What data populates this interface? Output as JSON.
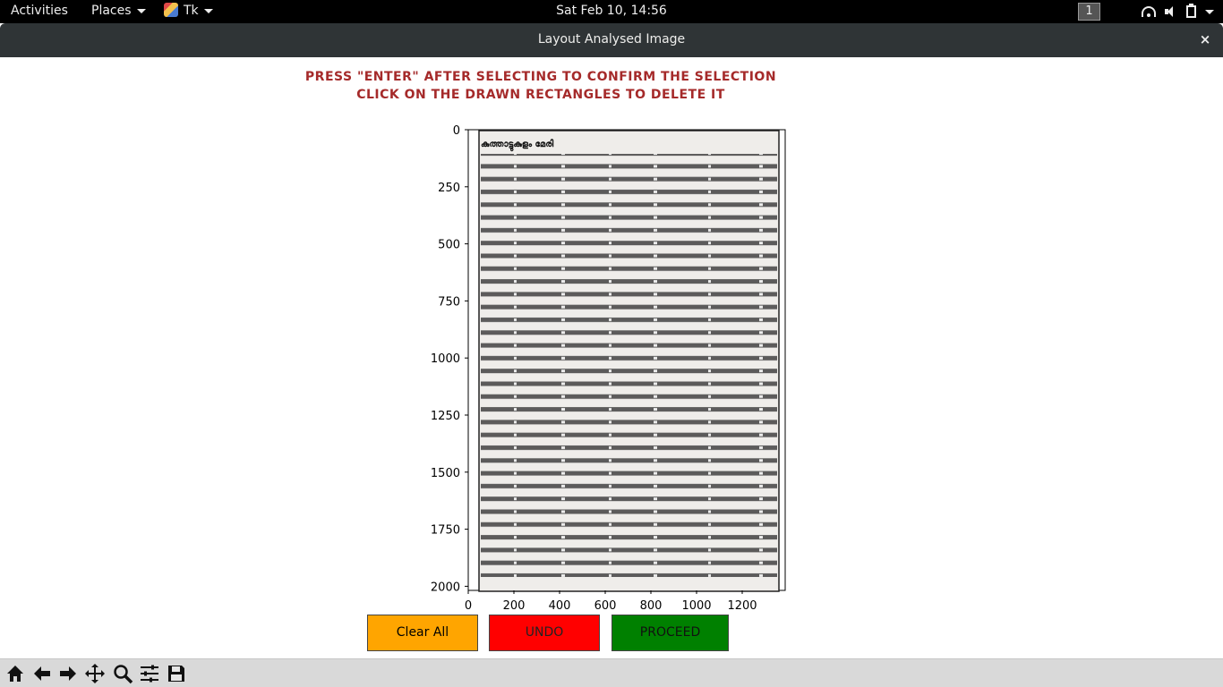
{
  "topbar": {
    "activities": "Activities",
    "places": "Places",
    "app_name": "Tk",
    "clock": "Sat Feb 10, 14:56",
    "workspace": "1"
  },
  "window": {
    "title": "Layout Analysed Image",
    "close": "×"
  },
  "instructions": {
    "line1": "PRESS \"ENTER\" AFTER SELECTING TO CONFIRM THE SELECTION",
    "line2": "CLICK ON THE DRAWN RECTANGLES TO DELETE IT"
  },
  "plot": {
    "y_ticks": [
      "0",
      "250",
      "500",
      "750",
      "1000",
      "1250",
      "1500",
      "1750",
      "2000"
    ],
    "x_ticks": [
      "0",
      "200",
      "400",
      "600",
      "800",
      "1000",
      "1200"
    ],
    "document_heading": "കുത്താട്ടുകുളം മേരി"
  },
  "buttons": {
    "clear_all": "Clear All",
    "undo": "UNDO",
    "proceed": "PROCEED"
  },
  "toolbar": {
    "tools": [
      "home-icon",
      "back-icon",
      "forward-icon",
      "pan-icon",
      "zoom-icon",
      "configure-subplots-icon",
      "save-icon"
    ]
  },
  "colors": {
    "instruction": "#a52a2a",
    "clear_all": "#ffa500",
    "undo": "#ff0000",
    "proceed": "#008000"
  }
}
